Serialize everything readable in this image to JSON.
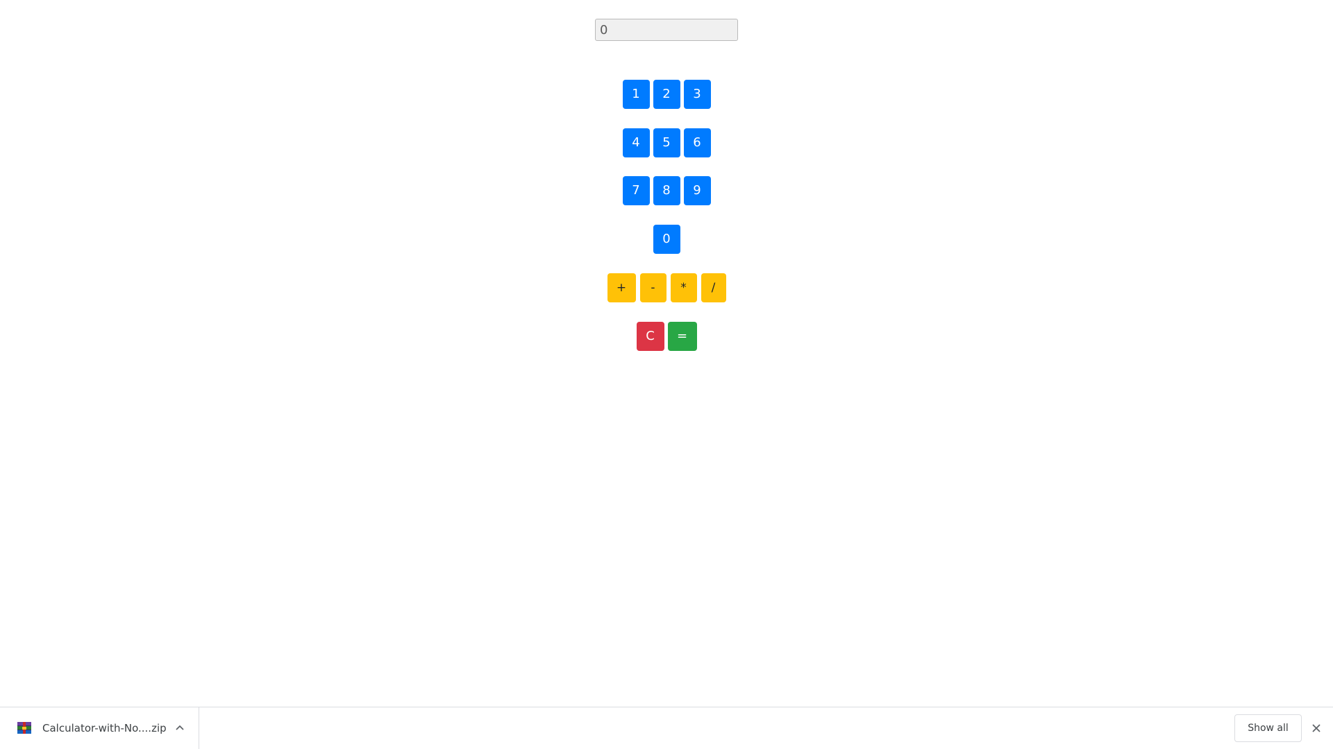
{
  "calculator": {
    "display_value": "0",
    "rows": [
      [
        "1",
        "2",
        "3"
      ],
      [
        "4",
        "5",
        "6"
      ],
      [
        "7",
        "8",
        "9"
      ],
      [
        "0"
      ]
    ],
    "operators": [
      "+",
      "-",
      "*",
      "/"
    ],
    "clear_label": "C",
    "equals_label": "=",
    "colors": {
      "number": "#007bff",
      "operator": "#ffc107",
      "clear": "#dc3545",
      "equals": "#28a745"
    }
  },
  "download_bar": {
    "file_name": "Calculator-with-No....zip",
    "file_icon": "winrar-archive-icon",
    "show_all_label": "Show all",
    "close_icon": "close-icon",
    "chevron_icon": "chevron-up-icon"
  }
}
